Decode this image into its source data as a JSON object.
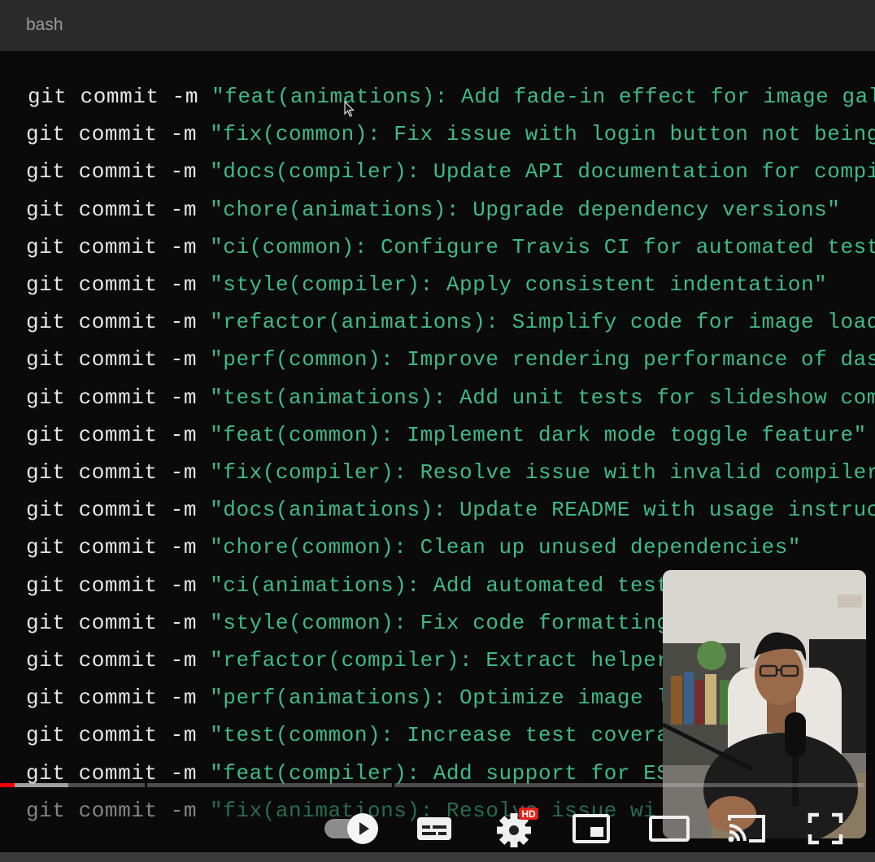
{
  "window": {
    "title": "bash"
  },
  "terminal": {
    "command": "git commit -m",
    "lines": [
      "\"feat(animations): Add fade-in effect for image gal",
      "\"fix(common): Fix issue with login button not being",
      "\"docs(compiler): Update API documentation for compi",
      "\"chore(animations): Upgrade dependency versions\"",
      "\"ci(common): Configure Travis CI for automated test",
      "\"style(compiler): Apply consistent indentation\"",
      "\"refactor(animations): Simplify code for image load",
      "\"perf(common): Improve rendering performance of das",
      "\"test(animations): Add unit tests for slideshow com",
      "\"feat(common): Implement dark mode toggle feature\"",
      "\"fix(compiler): Resolve issue with invalid compiler",
      "\"docs(animations): Update README with usage instruc",
      "\"chore(common): Clean up unused dependencies\"",
      "\"ci(animations): Add automated test",
      "\"style(common): Fix code formatting",
      "\"refactor(compiler): Extract helper",
      "\"perf(animations): Optimize image l",
      "\"test(common): Increase test covera",
      "\"feat(compiler): Add support for ES",
      "\"fix(animations): Resolve issue wi"
    ]
  },
  "video_player": {
    "progress_played": 0.017,
    "progress_loaded": 0.079,
    "controls": {
      "autoplay": "on",
      "subtitles": "subtitles-icon",
      "settings": "settings-gear-icon",
      "quality_badge": "HD",
      "miniplayer": "miniplayer-icon",
      "theater": "theater-mode-icon",
      "cast": "cast-icon",
      "fullscreen": "fullscreen-icon"
    }
  },
  "colors": {
    "command": "#e6e6e6",
    "message": "#3fb98a",
    "progress_played": "#ff0000",
    "quality_badge": "#e62117"
  }
}
